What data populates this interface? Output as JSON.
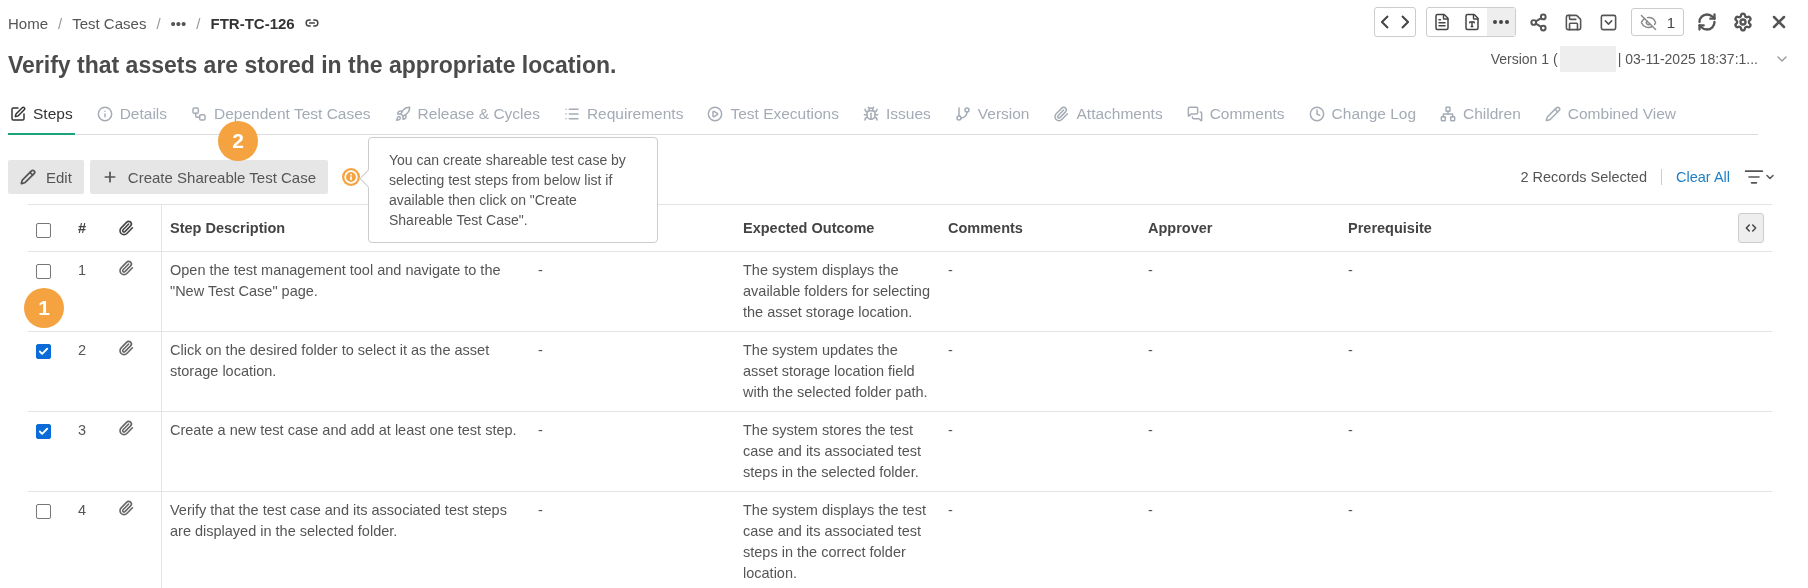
{
  "breadcrumb": [
    {
      "label": "Home",
      "current": false
    },
    {
      "separator": "/",
      "label": "Test Cases",
      "current": false
    },
    {
      "separator": "/",
      "label": "•••",
      "current": false
    },
    {
      "separator": "/",
      "label": "FTR-TC-126",
      "current": true
    }
  ],
  "toolbar": {
    "hidden_count": "1"
  },
  "title": "Verify that assets are stored in the appropriate location.",
  "version": {
    "label": "Version 1 (",
    "date": "| 03-11-2025 18:37:1..."
  },
  "tabs": [
    {
      "label": "Steps",
      "selected": true
    },
    {
      "label": "Details",
      "selected": false
    },
    {
      "label": "Dependent Test Cases",
      "selected": false
    },
    {
      "label": "Release & Cycles",
      "selected": false
    },
    {
      "label": "Requirements",
      "selected": false
    },
    {
      "label": "Test Executions",
      "selected": false
    },
    {
      "label": "Issues",
      "selected": false
    },
    {
      "label": "Version",
      "selected": false
    },
    {
      "label": "Attachments",
      "selected": false
    },
    {
      "label": "Comments",
      "selected": false
    },
    {
      "label": "Change Log",
      "selected": false
    },
    {
      "label": "Children",
      "selected": false
    },
    {
      "label": "Combined View",
      "selected": false
    }
  ],
  "actions": [
    {
      "label": "Edit"
    },
    {
      "label": "Create Shareable Test Case"
    }
  ],
  "tooltip": "You can create shareable test case by selecting test steps from below list if available then click on \"Create Shareable Test Case\".",
  "selection": {
    "count": "2 Records Selected",
    "clear": "Clear All"
  },
  "tour_badges": [
    {
      "label": "1"
    },
    {
      "label": "2"
    }
  ],
  "table": {
    "all_checked": false,
    "columns": {
      "number": "#",
      "step": "Step Description",
      "expected": "Expected Outcome",
      "comments": "Comments",
      "approver": "Approver",
      "prerequisite": "Prerequisite"
    },
    "rows": [
      {
        "checked": false,
        "number": "1",
        "step": "Open the test management tool and navigate to the \"New Test Case\" page.",
        "column_5": "-",
        "expected": "The system displays the available folders for selecting the asset storage location.",
        "comments": "-",
        "approver": "-",
        "prerequisite": "-"
      },
      {
        "checked": true,
        "number": "2",
        "step": "Click on the desired folder to select it as the asset storage location.",
        "column_5": "-",
        "expected": "The system updates the asset storage location field with the selected folder path.",
        "comments": "-",
        "approver": "-",
        "prerequisite": "-"
      },
      {
        "checked": true,
        "number": "3",
        "step": "Create a new test case and add at least one test step.",
        "column_5": "-",
        "expected": "The system stores the test case and its associated test steps in the selected folder.",
        "comments": "-",
        "approver": "-",
        "prerequisite": "-"
      },
      {
        "checked": false,
        "number": "4",
        "step": "Verify that the test case and its associated test steps are displayed in the selected folder.",
        "column_5": "-",
        "expected": "The system displays the test case and its associated test steps in the correct folder location.",
        "comments": "-",
        "approver": "-",
        "prerequisite": "-"
      }
    ]
  }
}
